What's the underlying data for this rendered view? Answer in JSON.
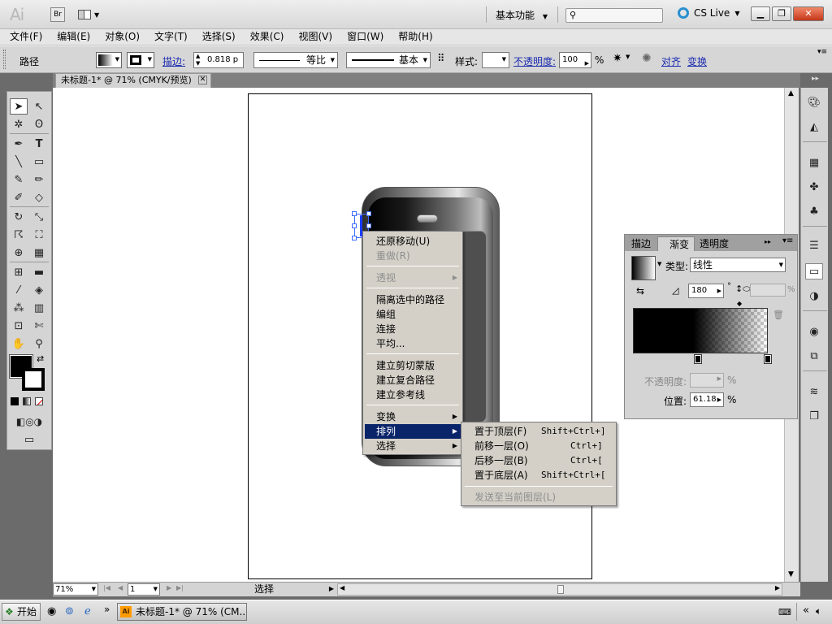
{
  "app": {
    "logo": "Ai",
    "bridge_label": "Br",
    "workspace": "基本功能",
    "cs_live": "CS Live"
  },
  "menubar": [
    "文件(F)",
    "编辑(E)",
    "对象(O)",
    "文字(T)",
    "选择(S)",
    "效果(C)",
    "视图(V)",
    "窗口(W)",
    "帮助(H)"
  ],
  "controlbar": {
    "object_type": "路径",
    "stroke_label": "描边:",
    "stroke_value": "0.818 p",
    "profile_label": "等比",
    "brush_label": "基本",
    "style_label": "样式:",
    "opacity_label": "不透明度:",
    "opacity_value": "100",
    "percent": "%",
    "align_label": "对齐",
    "transform_label": "变换"
  },
  "document_tab": {
    "title": "未标题-1* @ 71% (CMYK/预览)"
  },
  "context_menu": {
    "items": [
      {
        "label": "还原移动(U)",
        "enabled": true
      },
      {
        "label": "重做(R)",
        "enabled": false
      },
      {
        "label": "透视",
        "enabled": false,
        "submenu": true
      },
      {
        "label": "隔离选中的路径",
        "enabled": true
      },
      {
        "label": "编组",
        "enabled": true
      },
      {
        "label": "连接",
        "enabled": true
      },
      {
        "label": "平均...",
        "enabled": true
      },
      {
        "label": "建立剪切蒙版",
        "enabled": true
      },
      {
        "label": "建立复合路径",
        "enabled": true
      },
      {
        "label": "建立参考线",
        "enabled": true
      },
      {
        "label": "变换",
        "enabled": true,
        "submenu": true
      },
      {
        "label": "排列",
        "enabled": true,
        "submenu": true,
        "highlighted": true
      },
      {
        "label": "选择",
        "enabled": true,
        "submenu": true
      }
    ]
  },
  "arrange_submenu": {
    "items": [
      {
        "label": "置于顶层(F)",
        "shortcut": "Shift+Ctrl+]"
      },
      {
        "label": "前移一层(O)",
        "shortcut": "Ctrl+]"
      },
      {
        "label": "后移一层(B)",
        "shortcut": "Ctrl+["
      },
      {
        "label": "置于底层(A)",
        "shortcut": "Shift+Ctrl+["
      },
      {
        "label": "发送至当前图层(L)",
        "shortcut": "",
        "enabled": false
      }
    ]
  },
  "gradient_panel": {
    "tabs": [
      "描边",
      "渐变",
      "透明度"
    ],
    "active_tab": "渐变",
    "type_label": "类型:",
    "type_value": "线性",
    "angle_value": "180",
    "degree": "°",
    "opacity_label": "不透明度:",
    "location_label": "位置:",
    "location_value": "61.18",
    "percent": "%"
  },
  "statusbar": {
    "zoom": "71%",
    "page": "1",
    "tool_label": "选择"
  },
  "taskbar": {
    "start": "开始",
    "task": "未标题-1* @ 71% (CM..."
  },
  "colors": {
    "highlight": "#0a246a",
    "menu_bg": "#d4d0c8",
    "link": "#1a2bb0"
  }
}
